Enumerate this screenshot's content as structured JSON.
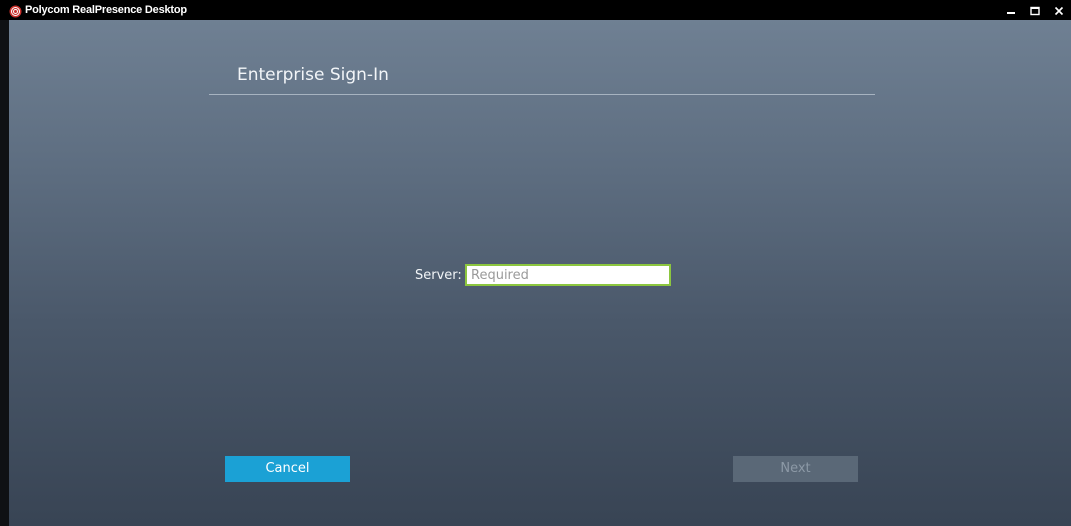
{
  "window": {
    "title": "Polycom RealPresence Desktop",
    "controls": {
      "minimize_icon": "minimize-icon",
      "maximize_icon": "maximize-icon",
      "close_icon": "close-icon"
    }
  },
  "main": {
    "heading": "Enterprise Sign-In",
    "server_label": "Server:",
    "server_value": "",
    "server_placeholder": "Required",
    "cancel_label": "Cancel",
    "next_label": "Next"
  },
  "colors": {
    "accent": "#1ba1d5",
    "input_focus_border": "#8cc63f",
    "disabled_button": "#5a6877"
  }
}
